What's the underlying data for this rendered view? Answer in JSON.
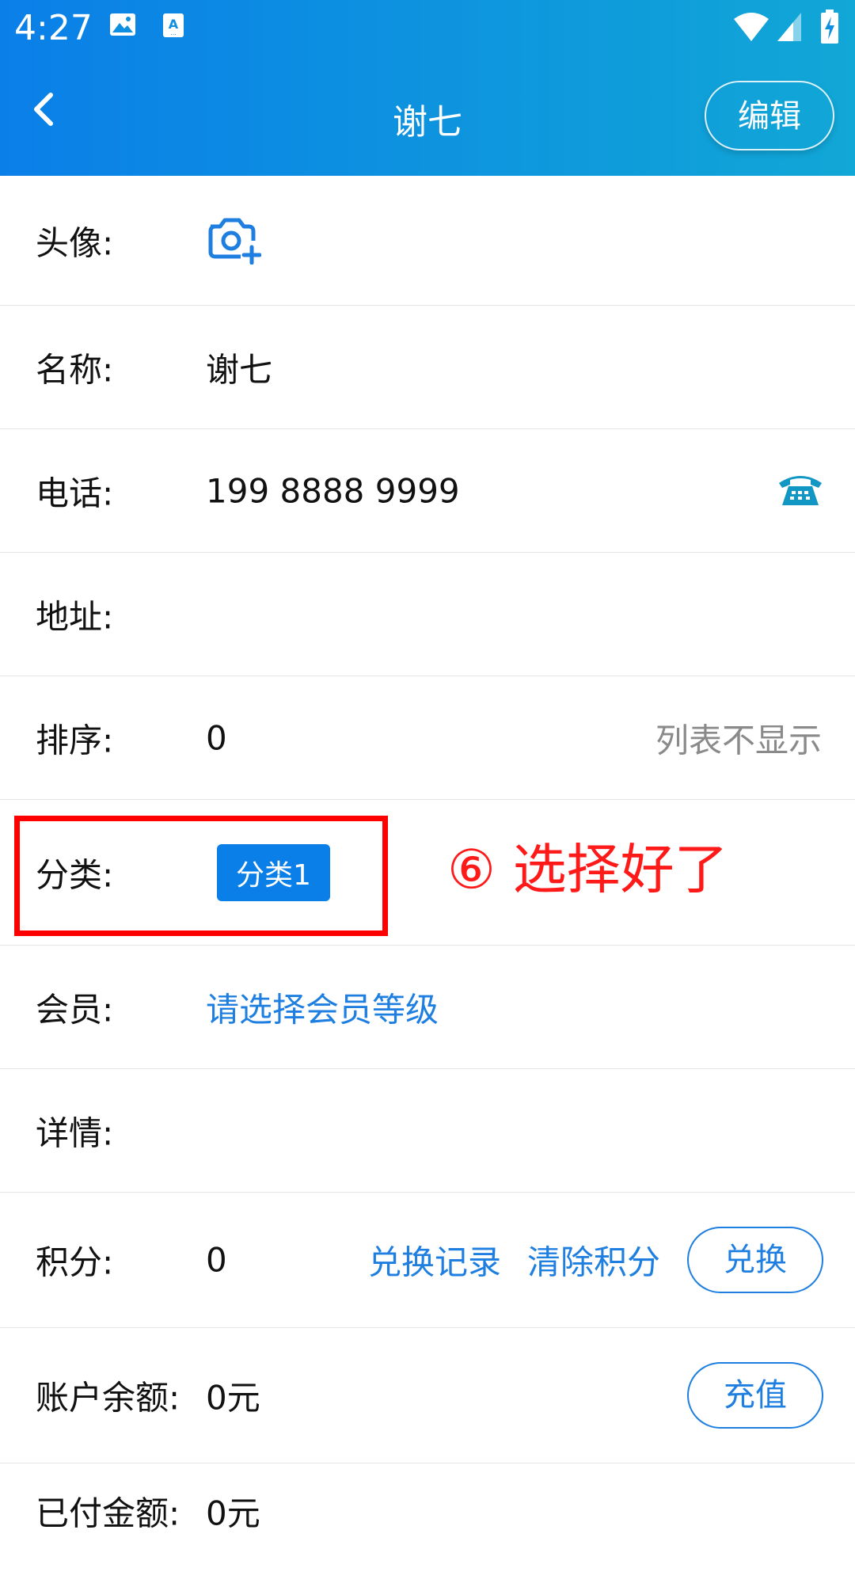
{
  "status_bar": {
    "time": "4:27",
    "icons": [
      "image-icon",
      "a-badge-icon",
      "wifi-icon",
      "signal-icon",
      "battery-charging-icon"
    ]
  },
  "nav": {
    "title": "谢七",
    "edit_label": "编辑",
    "back_icon": "chevron-left-icon"
  },
  "colors": {
    "header_start": "#0a7fe8",
    "header_end": "#11a7d6",
    "accent": "#1e7fe0",
    "annotation": "#ff0000"
  },
  "form": {
    "avatar": {
      "label": "头像:",
      "icon": "camera-add-icon"
    },
    "name": {
      "label": "名称:",
      "value": "谢七"
    },
    "phone": {
      "label": "电话:",
      "value": "199 8888 9999",
      "icon": "telephone-icon"
    },
    "address": {
      "label": "地址:",
      "value": ""
    },
    "sort": {
      "label": "排序:",
      "value": "0",
      "note": "列表不显示"
    },
    "category": {
      "label": "分类:",
      "tag": "分类1"
    },
    "member": {
      "label": "会员:",
      "placeholder": "请选择会员等级"
    },
    "detail": {
      "label": "详情:",
      "value": ""
    },
    "points": {
      "label": "积分:",
      "value": "0",
      "history_link": "兑换记录",
      "clear_link": "清除积分",
      "redeem_button": "兑换"
    },
    "balance": {
      "label": "账户余额:",
      "value": "0元",
      "recharge_button": "充值"
    },
    "paid": {
      "label": "已付金额:",
      "value": "0元"
    }
  },
  "annotation": "⑥ 选择好了"
}
